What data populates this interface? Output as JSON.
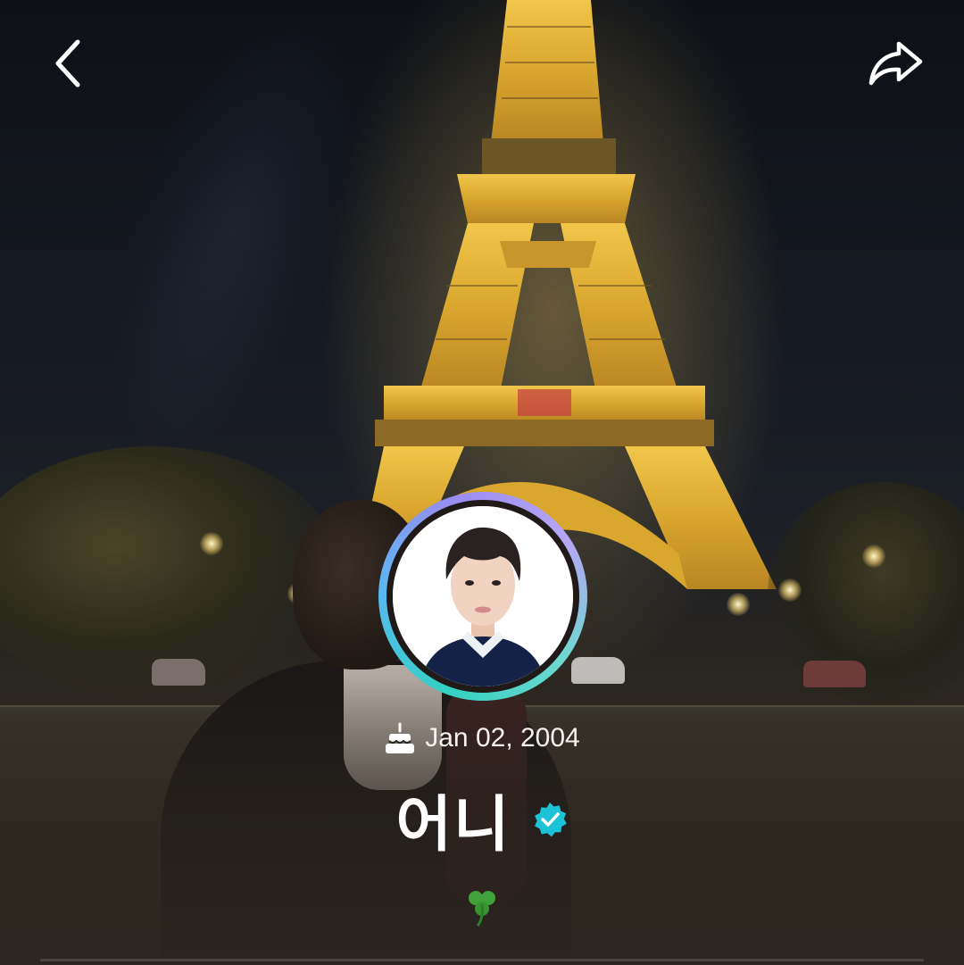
{
  "header": {
    "back_icon": "chevron-left-icon",
    "share_icon": "share-arrow-icon"
  },
  "profile": {
    "birthday": "Jan 02, 2004",
    "birthday_icon": "cake-icon",
    "name": "어니",
    "verified_icon": "verified-badge-icon",
    "verified_color": "#1cc3d6",
    "status_icon": "clover-icon",
    "avatar_ring_colors": [
      "#33d1c2",
      "#5ab8f0",
      "#9a8cf2"
    ]
  }
}
